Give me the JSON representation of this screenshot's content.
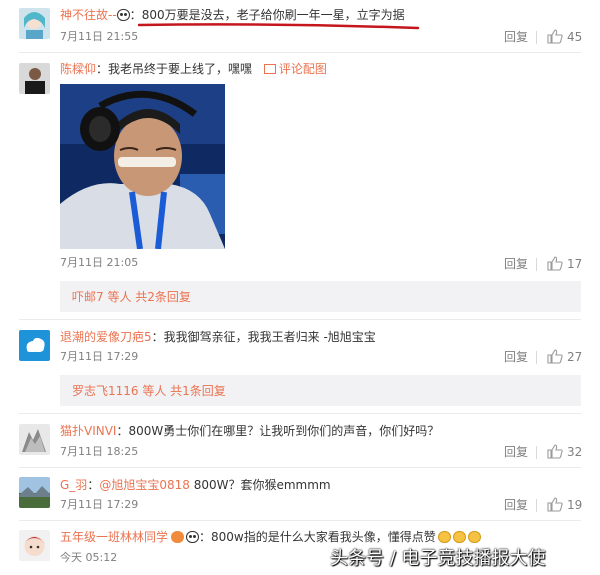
{
  "comments": [
    {
      "username": "神不往故--",
      "separator": "：",
      "text": "800万要是没去，老子给你刷一年一星，立字为据",
      "time": "7月11日 21:55",
      "reply": "回复",
      "likes": "45"
    },
    {
      "username": "陈樑仰",
      "separator": "：",
      "text": "我老吊终于要上线了，嘿嘿",
      "image_link": "评论配图",
      "time": "7月11日 21:05",
      "reply": "回复",
      "likes": "17",
      "sub_summary": "吓邮7 等人 共2条回复"
    },
    {
      "username": "退潮的爱像刀疤5",
      "separator": "：",
      "text": "我我御驾亲征，我我王者归来 -旭旭宝宝",
      "time": "7月11日 17:29",
      "reply": "回复",
      "likes": "27",
      "sub_summary": "罗志飞1116 等人 共1条回复"
    },
    {
      "username": "猫扑VINVI",
      "separator": "：",
      "text": "800W勇士你们在哪里？让我听到你们的声音，你们好吗？",
      "time": "7月11日 18:25",
      "reply": "回复",
      "likes": "32"
    },
    {
      "username": "G_羽",
      "separator": "：",
      "mention": "@旭旭宝宝0818",
      "text": " 800W？套你猴emmmm",
      "time": "7月11日 17:29",
      "reply": "回复",
      "likes": "19"
    },
    {
      "username": "五年级一班林林同学",
      "separator": "：",
      "text": "800w指的是什么大家看我头像，懂得点赞",
      "time": "今天 05:12"
    }
  ],
  "watermark": "头条号 / 电子竞技播报大使",
  "colors": {
    "username": "#eb7350",
    "text": "#333333",
    "meta": "#808080",
    "underline": "#c4161c",
    "subbox_bg": "#f2f2f5"
  }
}
